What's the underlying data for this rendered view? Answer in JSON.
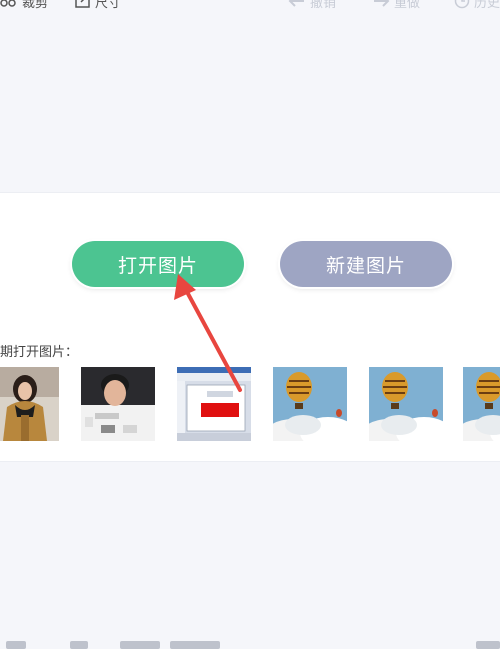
{
  "toolbar": {
    "crop_label": "裁剪",
    "size_label": "尺寸",
    "undo_label": "撤销",
    "redo_label": "重做",
    "history_label": "历史"
  },
  "main": {
    "open_button_label": "打开图片",
    "new_button_label": "新建图片",
    "recent_label": "期打开图片：",
    "thumbnails": [
      {
        "name": "photo-woman-coat"
      },
      {
        "name": "photo-man-selfie"
      },
      {
        "name": "screenshot-paint-window"
      },
      {
        "name": "photo-hot-air-balloon"
      },
      {
        "name": "photo-hot-air-balloon"
      },
      {
        "name": "photo-hot-air-balloon"
      }
    ]
  },
  "colors": {
    "open_button": "#4cc491",
    "new_button": "#9ea5c3",
    "arrow": "#e8463f",
    "background": "#f5f6fa"
  }
}
